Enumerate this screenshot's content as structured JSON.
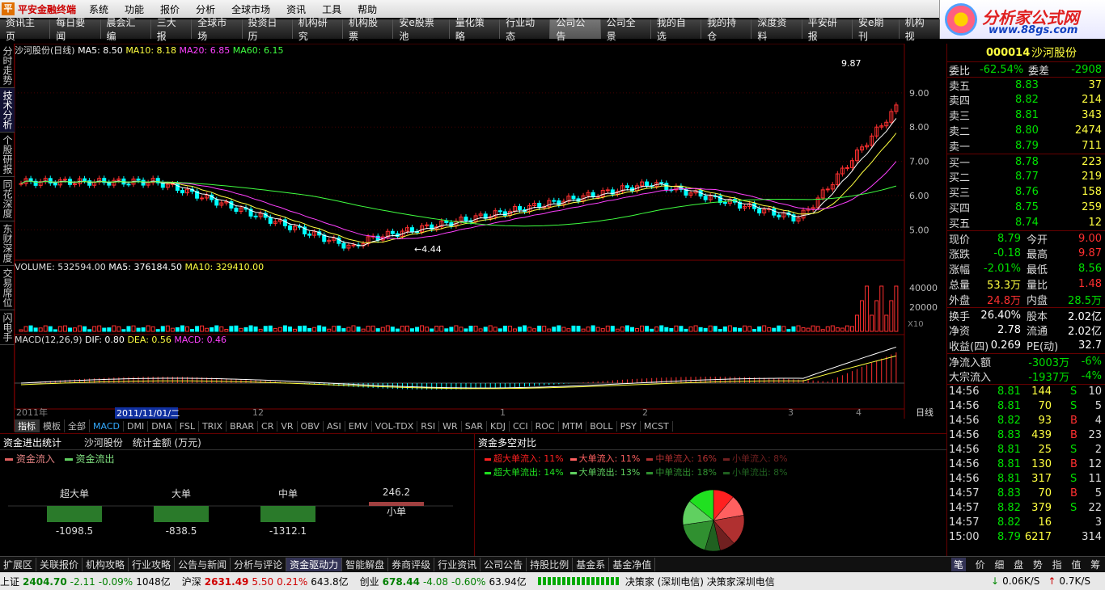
{
  "app": {
    "name": "平安金融终端"
  },
  "menu": [
    "系统",
    "功能",
    "报价",
    "分析",
    "全球市场",
    "资讯",
    "工具",
    "帮助"
  ],
  "brand": {
    "line1": "分析家公式网",
    "line2": "www.88gs.com"
  },
  "tabs": [
    "资讯主页",
    "每日要闻",
    "晨会汇编",
    "三大报",
    "全球市场",
    "投资日历",
    "机构研究",
    "机构股票",
    "安e股票池",
    "量化策略",
    "行业动态",
    "公司公告",
    "公司全景",
    "我的自选",
    "我的持仓",
    "深度资料",
    "平安研报",
    "安e期刊",
    "机构视"
  ],
  "active_tab": "公司公告",
  "side_tabs": [
    "分时走势",
    "技术分析",
    "个股研报",
    "同花深度",
    "东财深度",
    "交易席位",
    "闪电手"
  ],
  "active_side_tab": "技术分析",
  "price_chart": {
    "title": "沙河股份(日线)",
    "ma5": "MA5: 8.50",
    "ma10": "MA10: 8.18",
    "ma20": "MA20: 6.85",
    "ma60": "MA60: 6.15",
    "y_labels": [
      "9.00",
      "8.00",
      "7.00",
      "6.00",
      "5.00"
    ],
    "high_label": "9.87",
    "low_label": "4.44"
  },
  "volume_chart": {
    "title": "VOLUME: 532594.00",
    "ma5": "MA5: 376184.50",
    "ma10": "MA10: 329410.00",
    "y_labels": [
      "40000",
      "20000"
    ],
    "unit": "X10"
  },
  "macd_chart": {
    "title": "MACD(12,26,9)",
    "dif": "DIF: 0.80",
    "dea": "DEA: 0.56",
    "macd": "MACD: 0.46"
  },
  "x_axis": {
    "year": "2011年",
    "cursor_date": "2011/11/01/二",
    "months": [
      "12",
      "1",
      "2",
      "3",
      "4"
    ],
    "period": "日线"
  },
  "indicator_tabs": [
    "指标",
    "模板",
    "全部",
    "MACD",
    "DMI",
    "DMA",
    "FSL",
    "TRIX",
    "BRAR",
    "CR",
    "VR",
    "OBV",
    "ASI",
    "EMV",
    "VOL-TDX",
    "RSI",
    "WR",
    "SAR",
    "KDJ",
    "CCI",
    "ROC",
    "MTM",
    "BOLL",
    "PSY",
    "MCST"
  ],
  "fund_flow": {
    "title": "资金进出统计",
    "stock": "沙河股份",
    "unit": "统计金额 (万元)",
    "legend_in": "资金流入",
    "legend_out": "资金流出",
    "bars": [
      {
        "label": "超大单",
        "value": -1098.5
      },
      {
        "label": "大单",
        "value": -838.5
      },
      {
        "label": "中单",
        "value": -1312.1
      },
      {
        "label": "小单",
        "value": 246.2
      }
    ]
  },
  "fund_ratio": {
    "title": "资金多空对比",
    "inflow": [
      {
        "label": "超大单流入: 11%",
        "color": "#ff2020"
      },
      {
        "label": "大单流入: 11%",
        "color": "#ff6060"
      },
      {
        "label": "中单流入: 16%",
        "color": "#b03030"
      },
      {
        "label": "小单流入: 8%",
        "color": "#702020"
      }
    ],
    "outflow": [
      {
        "label": "超大单流出: 14%",
        "color": "#20e020"
      },
      {
        "label": "大单流出: 13%",
        "color": "#60d060"
      },
      {
        "label": "中单流出: 18%",
        "color": "#309030"
      },
      {
        "label": "小单流出: 8%",
        "color": "#206020"
      }
    ],
    "chart_data": {
      "type": "pie",
      "labels": [
        "超大单流入",
        "大单流入",
        "中单流入",
        "小单流入",
        "小单流出",
        "中单流出",
        "大单流出",
        "超大单流出"
      ],
      "values": [
        11,
        11,
        16,
        8,
        8,
        18,
        13,
        14
      ],
      "colors": [
        "#ff2020",
        "#ff6060",
        "#b03030",
        "#702020",
        "#206020",
        "#309030",
        "#60d060",
        "#20e020"
      ]
    }
  },
  "module_tabs": [
    "扩展区",
    "关联报价",
    "机构攻略",
    "行业攻略",
    "公告与新闻",
    "分析与评论",
    "资金驱动力",
    "智能解盘",
    "券商评级",
    "行业资讯",
    "公司公告",
    "持股比例",
    "基金系",
    "基金净值"
  ],
  "active_module_tab": "资金驱动力",
  "quote": {
    "code": "000014",
    "name": "沙河股份",
    "weibi_label": "委比",
    "weibi": "-62.54%",
    "weicha_label": "委差",
    "weicha": "-2908",
    "sell": [
      {
        "label": "卖五",
        "price": "8.83",
        "vol": "37"
      },
      {
        "label": "卖四",
        "price": "8.82",
        "vol": "214"
      },
      {
        "label": "卖三",
        "price": "8.81",
        "vol": "343"
      },
      {
        "label": "卖二",
        "price": "8.80",
        "vol": "2474"
      },
      {
        "label": "卖一",
        "price": "8.79",
        "vol": "711"
      }
    ],
    "buy": [
      {
        "label": "买一",
        "price": "8.78",
        "vol": "223"
      },
      {
        "label": "买二",
        "price": "8.77",
        "vol": "219"
      },
      {
        "label": "买三",
        "price": "8.76",
        "vol": "158"
      },
      {
        "label": "买四",
        "price": "8.75",
        "vol": "259"
      },
      {
        "label": "买五",
        "price": "8.74",
        "vol": "12"
      }
    ],
    "stats": [
      {
        "l1": "现价",
        "v1": "8.79",
        "c1": "#00e000",
        "l2": "今开",
        "v2": "9.00",
        "c2": "#ff3030"
      },
      {
        "l1": "涨跌",
        "v1": "-0.18",
        "c1": "#00e000",
        "l2": "最高",
        "v2": "9.87",
        "c2": "#ff3030"
      },
      {
        "l1": "涨幅",
        "v1": "-2.01%",
        "c1": "#00e000",
        "l2": "最低",
        "v2": "8.56",
        "c2": "#00e000"
      },
      {
        "l1": "总量",
        "v1": "53.3万",
        "c1": "#ffff40",
        "l2": "量比",
        "v2": "1.48",
        "c2": "#ff3030"
      },
      {
        "l1": "外盘",
        "v1": "24.8万",
        "c1": "#ff3030",
        "l2": "内盘",
        "v2": "28.5万",
        "c2": "#00e000"
      }
    ],
    "stats2": [
      {
        "l1": "换手",
        "v1": "26.40%",
        "l2": "股本",
        "v2": "2.02亿"
      },
      {
        "l1": "净资",
        "v1": "2.78",
        "l2": "流通",
        "v2": "2.02亿"
      },
      {
        "l1": "收益(四)",
        "v1": "0.269",
        "l2": "PE(动)",
        "v2": "32.7"
      }
    ],
    "netflow": [
      {
        "label": "净流入额",
        "value": "-3003万",
        "pct": "-6%"
      },
      {
        "label": "大宗流入",
        "value": "-1937万",
        "pct": "-4%"
      }
    ],
    "ticks": [
      {
        "time": "14:56",
        "price": "8.81",
        "vol": "144",
        "bs": "S",
        "n": "10"
      },
      {
        "time": "14:56",
        "price": "8.81",
        "vol": "70",
        "bs": "S",
        "n": "5"
      },
      {
        "time": "14:56",
        "price": "8.82",
        "vol": "93",
        "bs": "B",
        "n": "4"
      },
      {
        "time": "14:56",
        "price": "8.83",
        "vol": "439",
        "bs": "B",
        "n": "23"
      },
      {
        "time": "14:56",
        "price": "8.81",
        "vol": "25",
        "bs": "S",
        "n": "2"
      },
      {
        "time": "14:56",
        "price": "8.81",
        "vol": "130",
        "bs": "B",
        "n": "12"
      },
      {
        "time": "14:56",
        "price": "8.81",
        "vol": "317",
        "bs": "S",
        "n": "11"
      },
      {
        "time": "14:57",
        "price": "8.83",
        "vol": "70",
        "bs": "B",
        "n": "5"
      },
      {
        "time": "14:57",
        "price": "8.82",
        "vol": "379",
        "bs": "S",
        "n": "22"
      },
      {
        "time": "14:57",
        "price": "8.82",
        "vol": "16",
        "bs": "",
        "n": "3"
      },
      {
        "time": "15:00",
        "price": "8.79",
        "vol": "6217",
        "bs": "",
        "n": "314"
      }
    ],
    "footer_tabs": [
      "笔",
      "价",
      "细",
      "盘",
      "势",
      "指",
      "值",
      "筹"
    ]
  },
  "statusbar": {
    "items": [
      {
        "name": "上证",
        "price": "2404.70",
        "chg": "-2.11",
        "pct": "-0.09%",
        "amt": "1048亿"
      },
      {
        "name": "沪深",
        "price": "2631.49",
        "chg": "5.50",
        "pct": "0.21%",
        "amt": "643.8亿"
      },
      {
        "name": "创业",
        "price": "678.44",
        "chg": "-4.08",
        "pct": "-0.60%",
        "amt": "63.94亿"
      }
    ],
    "server": "决策家 (深圳电信)  决策家深圳电信",
    "down": "0.06K/S",
    "up": "0.7K/S"
  }
}
